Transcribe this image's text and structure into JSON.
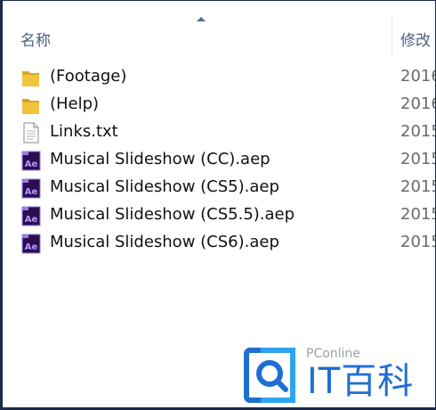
{
  "header": {
    "name_label": "名称",
    "date_label": "修改"
  },
  "files": [
    {
      "name": "(Footage)",
      "date": "2016",
      "icon": "folder-icon"
    },
    {
      "name": "(Help)",
      "date": "2016",
      "icon": "folder-icon"
    },
    {
      "name": "Links.txt",
      "date": "2015",
      "icon": "text-file-icon"
    },
    {
      "name": "Musical Slideshow (CC).aep",
      "date": "2015",
      "icon": "after-effects-file-icon"
    },
    {
      "name": "Musical Slideshow (CS5).aep",
      "date": "2015",
      "icon": "after-effects-file-icon"
    },
    {
      "name": "Musical Slideshow (CS5.5).aep",
      "date": "2015",
      "icon": "after-effects-file-icon"
    },
    {
      "name": "Musical Slideshow (CS6).aep",
      "date": "2015",
      "icon": "after-effects-file-icon"
    }
  ],
  "watermark": {
    "site": "PConline",
    "brand": "IT百科"
  },
  "colors": {
    "folder": "#e8b833",
    "ae_bg": "#2b0f52",
    "ae_text": "#b79bff",
    "header_text": "#4c5f80",
    "watermark_blue": "#1f6fd1"
  }
}
